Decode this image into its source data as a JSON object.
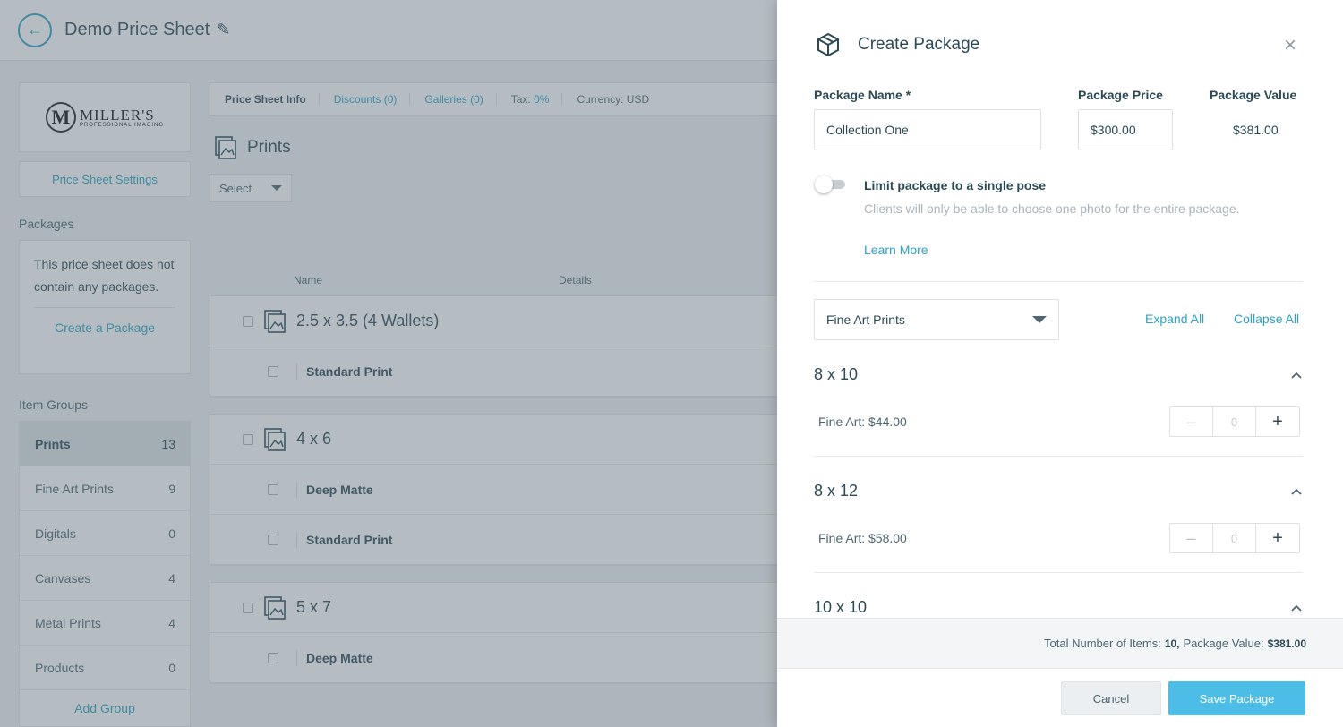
{
  "header": {
    "title": "Demo Price Sheet"
  },
  "sidebar": {
    "logo": {
      "main": "MILLER'S",
      "sub": "PROFESSIONAL IMAGING",
      "letter": "M"
    },
    "settings_label": "Price Sheet Settings",
    "packages_label": "Packages",
    "packages_empty": "This price sheet does not contain any packages.",
    "create_package_link": "Create a Package",
    "item_groups_label": "Item Groups",
    "groups": [
      {
        "name": "Prints",
        "count": "13"
      },
      {
        "name": "Fine Art Prints",
        "count": "9"
      },
      {
        "name": "Digitals",
        "count": "0"
      },
      {
        "name": "Canvases",
        "count": "4"
      },
      {
        "name": "Metal Prints",
        "count": "4"
      },
      {
        "name": "Products",
        "count": "0"
      }
    ],
    "add_group": "Add Group"
  },
  "main": {
    "info_bar": {
      "price_sheet_info": "Price Sheet Info",
      "discounts": "Discounts (0)",
      "galleries": "Galleries (0)",
      "tax_label": "Tax:",
      "tax_value": "0%",
      "currency": "Currency: USD"
    },
    "section_title": "Prints",
    "select_label": "Select",
    "columns": {
      "name": "Name",
      "details": "Details"
    },
    "products": [
      {
        "title": "2.5 x 3.5 (4 Wallets)",
        "variants": [
          "Standard Print"
        ]
      },
      {
        "title": "4 x 6",
        "variants": [
          "Deep Matte",
          "Standard Print"
        ]
      },
      {
        "title": "5 x 7",
        "variants": [
          "Deep Matte"
        ]
      }
    ]
  },
  "drawer": {
    "title": "Create Package",
    "package_name_label": "Package Name *",
    "package_name_value": "Collection One",
    "package_price_label": "Package Price",
    "package_price_value": "$300.00",
    "package_value_label": "Package Value",
    "package_value_value": "$381.00",
    "limit_title": "Limit package to a single pose",
    "limit_desc": "Clients will only be able to choose one photo for the entire package.",
    "learn_more": "Learn More",
    "category_value": "Fine Art Prints",
    "expand_all": "Expand All",
    "collapse_all": "Collapse All",
    "sizes": [
      {
        "title": "8 x 10",
        "item": "Fine Art: $44.00",
        "qty": "0"
      },
      {
        "title": "8 x 12",
        "item": "Fine Art: $58.00",
        "qty": "0"
      },
      {
        "title": "10 x 10"
      }
    ],
    "summary": {
      "items_label": "Total Number of Items:",
      "items_value": "10,",
      "value_label": "Package Value:",
      "value_value": "$381.00"
    },
    "cancel_label": "Cancel",
    "save_label": "Save Package"
  },
  "colors": {
    "accent": "#2aa3c8",
    "primary_button": "#4bbde6",
    "text": "#2c4a55"
  }
}
